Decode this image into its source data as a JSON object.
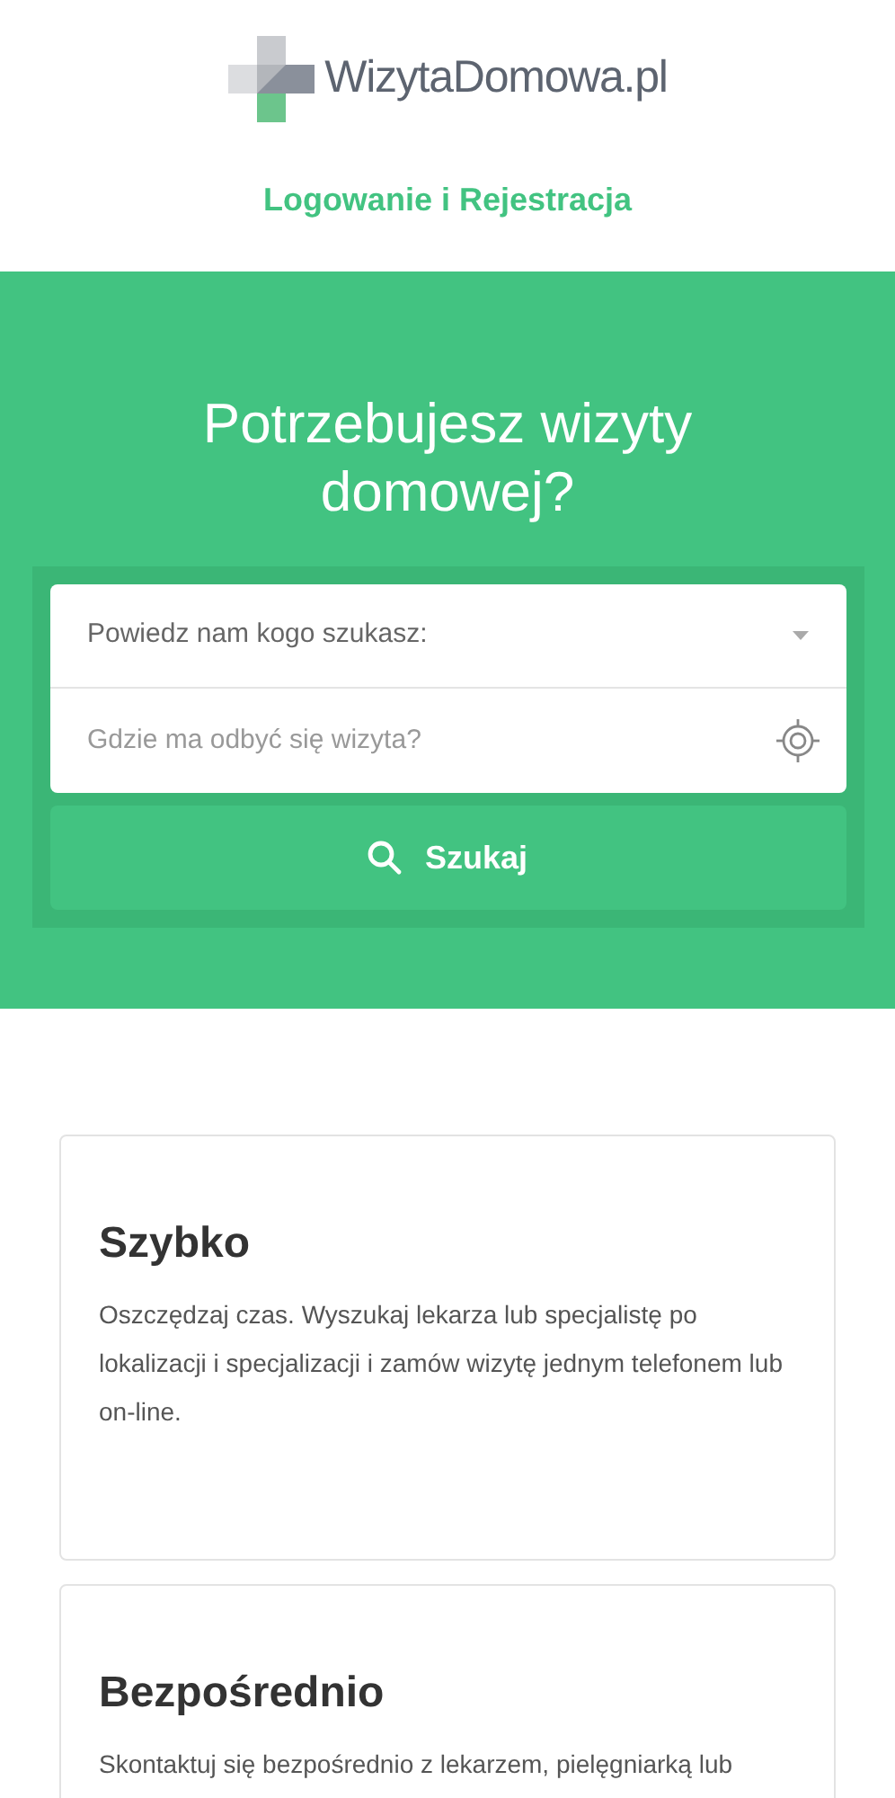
{
  "logo": {
    "text": "WizytaDomowa.pl"
  },
  "auth_link": "Logowanie i Rejestracja",
  "hero": {
    "title": "Potrzebujesz wizyty domowej?",
    "who_field": {
      "placeholder": "Powiedz nam kogo szukasz:"
    },
    "where_field": {
      "placeholder": "Gdzie ma odbyć się wizyta?"
    },
    "search_button": "Szukaj"
  },
  "features": [
    {
      "title": "Szybko",
      "text": "Oszczędzaj czas. Wyszukaj lekarza lub specjalistę po lokalizacji i specjalizacji i zamów wizytę jednym telefonem lub on-line."
    },
    {
      "title": "Bezpośrednio",
      "text": "Skontaktuj się bezpośrednio z lekarzem, pielęgniarką lub"
    }
  ]
}
